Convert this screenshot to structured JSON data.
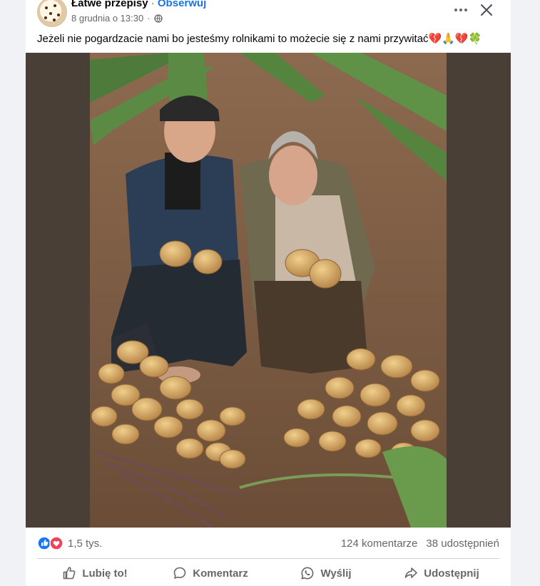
{
  "post": {
    "author": "Łatwe przepisy",
    "separator": " · ",
    "follow_label": "Obserwuj",
    "timestamp": "8 grudnia o 13:30",
    "text": "Jeżeli nie pogardzacie nami bo jesteśmy rolnikami to możecie się z nami przywitać💔🙏💔🍀",
    "image_alt": "Starsza para z ziemniakami na polu"
  },
  "icons": {
    "more": "more-options-icon",
    "close": "close-icon",
    "audience": "globe-icon",
    "like_reaction": "like-reaction-icon",
    "love_reaction": "love-reaction-icon",
    "like": "thumbs-up-icon",
    "comment": "comment-bubble-icon",
    "send": "whatsapp-icon",
    "share": "share-arrow-icon"
  },
  "stats": {
    "reactions": "1,5 tys.",
    "comments": "124 komentarze",
    "shares": "38 udostępnień"
  },
  "actions": {
    "like": "Lubię to!",
    "comment": "Komentarz",
    "send": "Wyślij",
    "share": "Udostępnij"
  },
  "colors": {
    "link_blue": "#1b74e4",
    "like_blue": "#1877f2",
    "love_red": "#f33e58",
    "muted_text": "#65676b",
    "photo_border": "#4a3f37"
  }
}
